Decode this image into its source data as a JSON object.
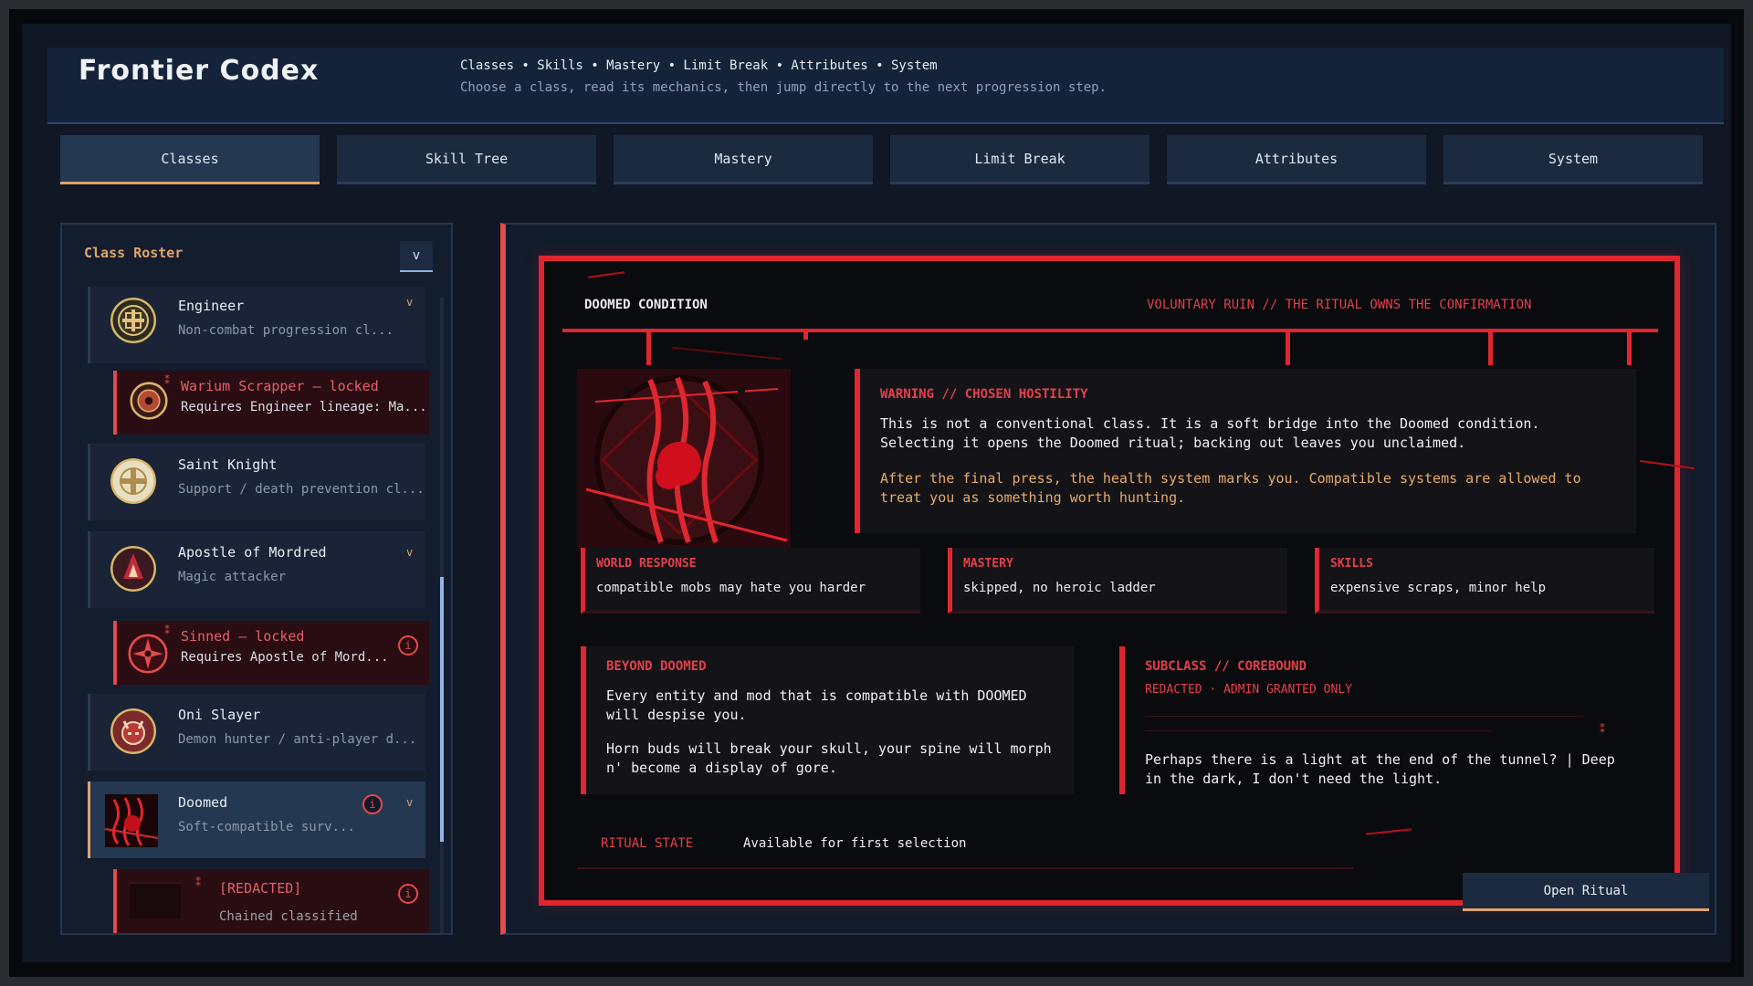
{
  "header": {
    "title": "Frontier Codex",
    "crumbs": "Classes • Skills • Mastery • Limit Break • Attributes • System",
    "subtitle": "Choose a class, read its mechanics, then jump directly to the next progression step."
  },
  "tabs": [
    "Classes",
    "Skill Tree",
    "Mastery",
    "Limit Break",
    "Attributes",
    "System"
  ],
  "active_tab": "Classes",
  "roster": {
    "title": "Class Roster",
    "toggle": "v",
    "items": [
      {
        "name": "Engineer",
        "desc": "Non-combat progression cl...",
        "chevron": "v"
      },
      {
        "name": "Warium Scrapper — locked",
        "desc": "Requires Engineer lineage: Ma...",
        "lock": "⁑"
      },
      {
        "name": "Saint Knight",
        "desc": "Support / death prevention cl..."
      },
      {
        "name": "Apostle of Mordred",
        "desc": "Magic attacker",
        "chevron": "v"
      },
      {
        "name": "Sinned — locked",
        "desc": "Requires Apostle of Mord...",
        "lock": "⁑",
        "info": "i"
      },
      {
        "name": "Oni Slayer",
        "desc": "Demon hunter / anti-player d..."
      },
      {
        "name": "Doomed",
        "desc": "Soft-compatible surv...",
        "info": "i",
        "chevron": "v"
      },
      {
        "name": "[REDACTED]",
        "desc": "Chained classified",
        "lock": "⁑",
        "info": "i"
      }
    ]
  },
  "doomed": {
    "title": "DOOMED CONDITION",
    "tag": "VOLUNTARY RUIN // THE RITUAL OWNS THE CONFIRMATION",
    "warning": {
      "heading": "WARNING // CHOSEN HOSTILITY",
      "p1": "This is not a conventional class. It is a soft bridge into the Doomed condition. Selecting it opens the Doomed ritual; backing out leaves you unclaimed.",
      "p2": "After the final press, the health system marks you. Compatible systems are allowed to treat you as something worth hunting."
    },
    "cards": [
      {
        "heading": "WORLD RESPONSE",
        "value": "compatible mobs may hate you harder"
      },
      {
        "heading": "MASTERY",
        "value": "skipped, no heroic ladder"
      },
      {
        "heading": "SKILLS",
        "value": "expensive scraps, minor help"
      }
    ],
    "beyond": {
      "heading": "BEYOND DOOMED",
      "p1": "Every entity and mod that is compatible with DOOMED will despise you.",
      "p2": "Horn buds will break your skull, your spine will morph n' become a display of gore."
    },
    "subclass": {
      "heading": "SUBCLASS // COREBOUND",
      "status": "REDACTED · ADMIN GRANTED ONLY",
      "mark": "⁑",
      "text": "Perhaps there is a light at the end of the tunnel? | Deep in the dark, I don't need the light."
    },
    "ritual": {
      "label": "RITUAL STATE",
      "value": "Available for first selection"
    },
    "open_button": "Open Ritual"
  },
  "colors": {
    "accent": "#e0a36a",
    "doom_red": "#e0262e",
    "panel": "#15233a"
  }
}
